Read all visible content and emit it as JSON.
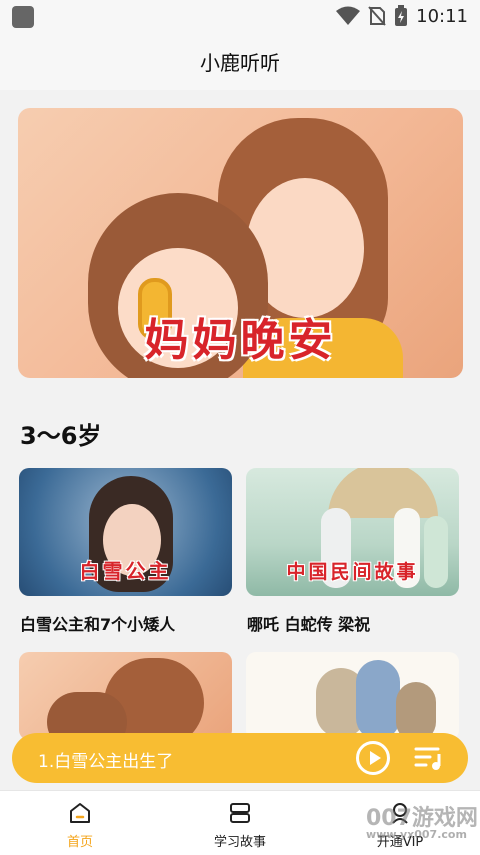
{
  "status_bar": {
    "time": "10:11",
    "icons": [
      "wifi-icon",
      "no-sim-icon",
      "battery-charging-icon"
    ]
  },
  "header": {
    "title": "小鹿听听"
  },
  "banner": {
    "caption": "妈妈晚安"
  },
  "section": {
    "title": "3～6岁"
  },
  "cards": [
    {
      "caption": "白雪公主",
      "label": "白雪公主和7个小矮人"
    },
    {
      "caption": "中国民间故事",
      "label": "哪吒 白蛇传 梁祝"
    },
    {
      "caption": "",
      "label": ""
    },
    {
      "caption": "",
      "label": ""
    }
  ],
  "player": {
    "now_playing": "1.白雪公主出生了",
    "icons": [
      "play-icon",
      "playlist-icon"
    ]
  },
  "nav": {
    "items": [
      {
        "label": "首页",
        "icon": "home-icon",
        "active": true
      },
      {
        "label": "学习故事",
        "icon": "stack-icon",
        "active": false
      },
      {
        "label": "开通VIP",
        "icon": "vip-icon",
        "active": false
      }
    ]
  },
  "watermark": {
    "text": "007游戏网",
    "url": "www.yx007.com"
  },
  "colors": {
    "accent": "#f8bd32",
    "active_nav": "#f4a51c",
    "caption_red": "#d8242a"
  }
}
